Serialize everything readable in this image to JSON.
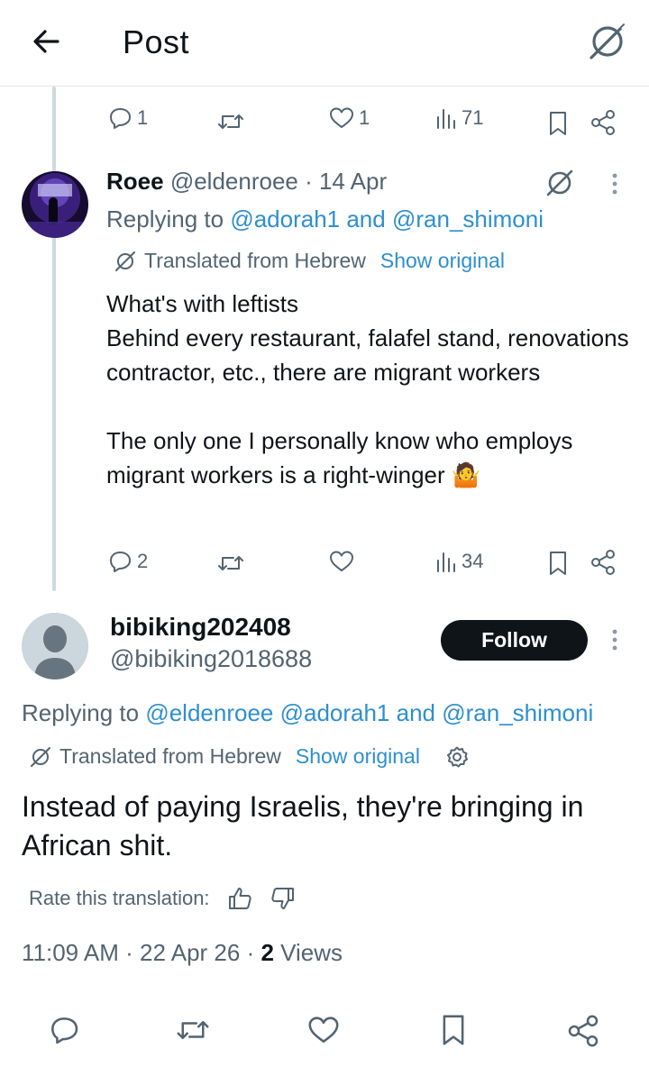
{
  "header": {
    "title": "Post"
  },
  "prev_actions": {
    "replies": "1",
    "reposts": "",
    "likes": "1",
    "views": "71"
  },
  "reply": {
    "name": "Roee",
    "handle_time": "@eldenroee · 14 Apr",
    "replying_prefix": "Replying to ",
    "replying_to": "@adorah1 and @ran_shimoni",
    "translated": "Translated from Hebrew",
    "show_original": "Show original",
    "text": "What's with leftists\nBehind every restaurant, falafel stand, renovations contractor, etc., there are migrant workers\n\nThe only one I personally know who employs migrant workers is a right-winger 🤷",
    "actions": {
      "replies": "2",
      "reposts": "",
      "likes": "",
      "views": "34"
    }
  },
  "main": {
    "name": "bibiking202408",
    "handle": "@bibiking2018688",
    "follow_label": "Follow",
    "replying_prefix": "Replying to ",
    "replying_to": "@eldenroee @adorah1 and @ran_shimoni",
    "translated": "Translated from Hebrew",
    "show_original": "Show original",
    "text": "Instead of paying Israelis, they're bringing in African shit.",
    "rate_label": "Rate this translation:",
    "time_date": "11:09 AM · 22 Apr 26 · ",
    "views_count": "2",
    "views_label": " Views"
  },
  "icons": {
    "back": "arrow-left-icon",
    "grok": "grok-icon",
    "reply": "speech-bubble-icon",
    "repost": "repost-icon",
    "like": "heart-icon",
    "views": "bar-chart-icon",
    "bookmark": "bookmark-icon",
    "share": "share-icon",
    "more": "more-vertical-icon",
    "settings": "gear-icon",
    "thumbs_up": "thumbs-up-icon",
    "thumbs_down": "thumbs-down-icon"
  },
  "colors": {
    "link": "#2e8fcf",
    "text": "#0f1419",
    "secondary": "#536471",
    "button": "#0f1419"
  }
}
